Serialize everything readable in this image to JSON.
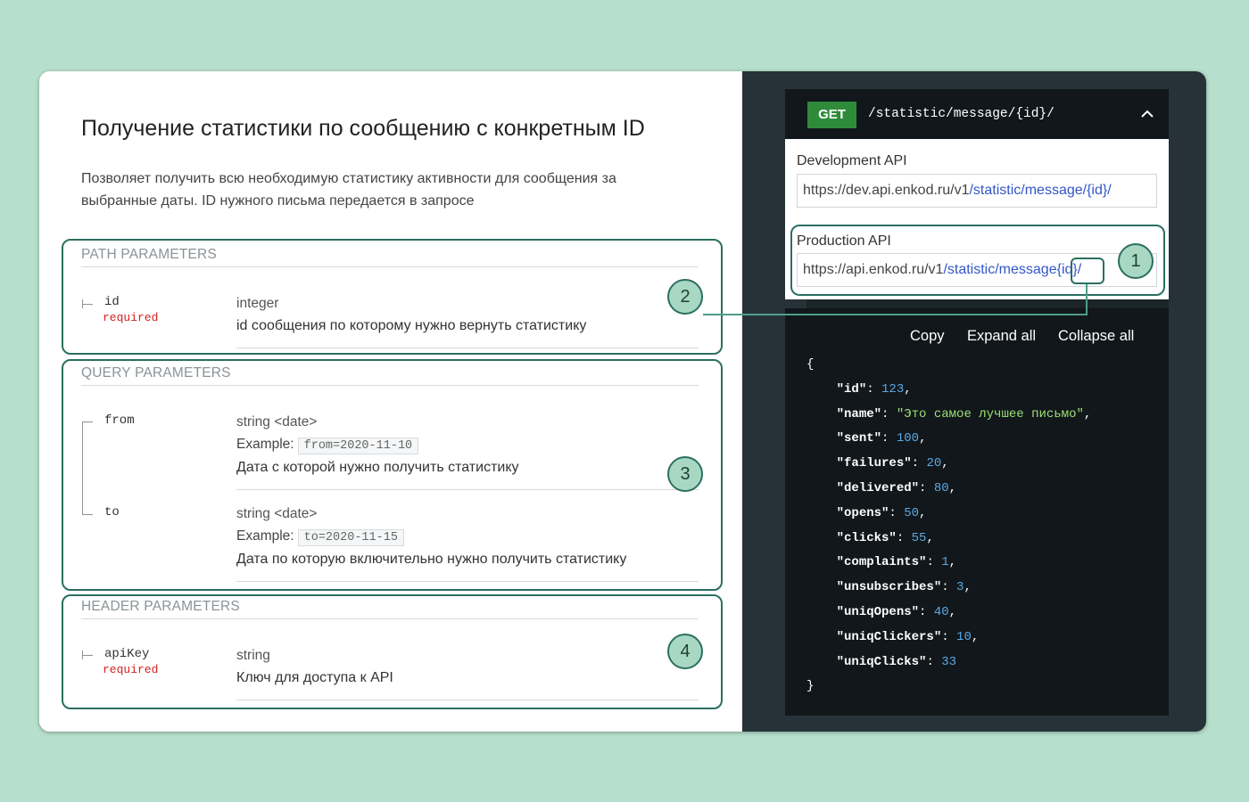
{
  "page": {
    "title": "Получение статистики по сообщению с конкретным ID",
    "description": "Позволяет получить всю необходимую статистику активности для сообщения за выбранные даты. ID нужного письма передается в запросе"
  },
  "path_params": {
    "title": "PATH PARAMETERS",
    "id": {
      "name": "id",
      "required": "required",
      "type": "integer",
      "description": "id сообщения по которому нужно вернуть статистику"
    }
  },
  "query_params": {
    "title": "QUERY PARAMETERS",
    "from": {
      "name": "from",
      "type": "string <date>",
      "example_label": "Example:",
      "example": "from=2020-11-10",
      "description": "Дата с которой нужно получить статистику"
    },
    "to": {
      "name": "to",
      "type": "string <date>",
      "example_label": "Example:",
      "example": "to=2020-11-15",
      "description": "Дата по которую включительно нужно получить статистику"
    }
  },
  "header_params": {
    "title": "HEADER PARAMETERS",
    "apiKey": {
      "name": "apiKey",
      "required": "required",
      "type": "string",
      "description": "Ключ для доступа к API"
    }
  },
  "endpoint": {
    "method": "GET",
    "path": "/statistic/message/{id}/"
  },
  "servers": {
    "dev": {
      "label": "Development API",
      "base": "https://dev.api.enkod.ru/v1",
      "path": "/statistic/message/{id}/"
    },
    "prod": {
      "label": "Production API",
      "base": "https://api.enkod.ru/v1",
      "path_a": "/statistic/message",
      "path_b": "{id}/"
    }
  },
  "response": {
    "copy_label": "Copy",
    "expand_label": "Expand all",
    "collapse_label": "Collapse all",
    "open_brace": "{",
    "close_brace": "}",
    "fields": [
      {
        "key": "\"id\"",
        "value": "123",
        "kind": "number",
        "comma": true
      },
      {
        "key": "\"name\"",
        "value": "\"Это самое лучшее письмо\"",
        "kind": "string",
        "comma": true
      },
      {
        "key": "\"sent\"",
        "value": "100",
        "kind": "number",
        "comma": true
      },
      {
        "key": "\"failures\"",
        "value": "20",
        "kind": "number",
        "comma": true
      },
      {
        "key": "\"delivered\"",
        "value": "80",
        "kind": "number",
        "comma": true
      },
      {
        "key": "\"opens\"",
        "value": "50",
        "kind": "number",
        "comma": true
      },
      {
        "key": "\"clicks\"",
        "value": "55",
        "kind": "number",
        "comma": true
      },
      {
        "key": "\"complaints\"",
        "value": "1",
        "kind": "number",
        "comma": true
      },
      {
        "key": "\"unsubscribes\"",
        "value": "3",
        "kind": "number",
        "comma": true
      },
      {
        "key": "\"uniqOpens\"",
        "value": "40",
        "kind": "number",
        "comma": true
      },
      {
        "key": "\"uniqClickers\"",
        "value": "10",
        "kind": "number",
        "comma": true
      },
      {
        "key": "\"uniqClicks\"",
        "value": "33",
        "kind": "number",
        "comma": false
      }
    ]
  },
  "callouts": {
    "one": "1",
    "two": "2",
    "three": "3",
    "four": "4"
  },
  "colors": {
    "background": "#b7dfcd",
    "highlight": "#2b6f60",
    "method_get": "#2e8b3a",
    "required": "#d41f1c"
  }
}
